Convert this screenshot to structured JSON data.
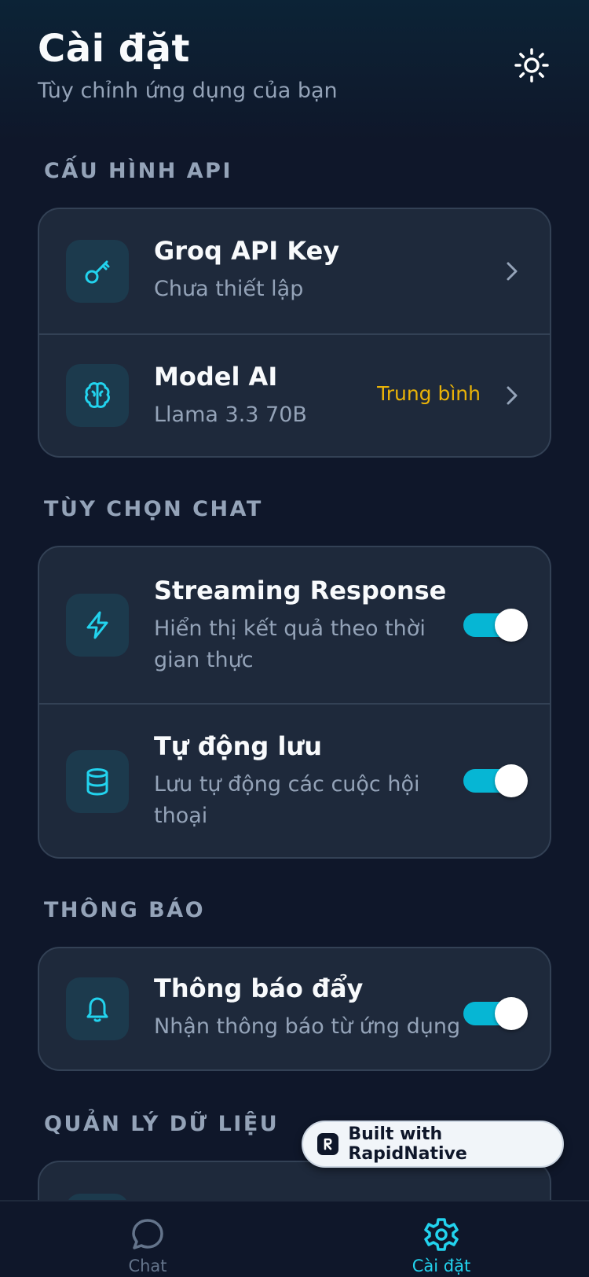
{
  "header": {
    "title": "Cài đặt",
    "subtitle": "Tùy chỉnh ứng dụng của bạn",
    "theme_icon": "sun-icon"
  },
  "sections": {
    "api": {
      "title": "CẤU HÌNH API",
      "groq": {
        "title": "Groq API Key",
        "subtitle": "Chưa thiết lập",
        "icon": "key-icon"
      },
      "model": {
        "title": "Model AI",
        "subtitle": "Llama 3.3 70B",
        "badge": "Trung bình",
        "icon": "brain-icon"
      }
    },
    "chat": {
      "title": "TÙY CHỌN CHAT",
      "streaming": {
        "title": "Streaming Response",
        "subtitle_line1": "Hiển thị kết quả theo thời",
        "subtitle_line2": "gian thực",
        "enabled": true,
        "icon": "lightning-icon"
      },
      "autosave": {
        "title": "Tự động lưu",
        "subtitle_line1": "Lưu tự động các cuộc hội",
        "subtitle_line2": "thoại",
        "enabled": true,
        "icon": "database-icon"
      }
    },
    "notifications": {
      "title": "THÔNG BÁO",
      "push": {
        "title": "Thông báo đẩy",
        "subtitle": "Nhận thông báo từ ứng dụng",
        "enabled": true,
        "icon": "bell-icon"
      }
    },
    "data": {
      "title": "QUẢN LÝ DỮ LIỆU"
    }
  },
  "built_badge": {
    "text": "Built with RapidNative"
  },
  "tabbar": {
    "tabs": [
      {
        "label": "Chat",
        "icon": "chat-bubble-icon",
        "active": false
      },
      {
        "label": "Cài đặt",
        "icon": "gear-icon",
        "active": true
      }
    ]
  },
  "colors": {
    "background": "#0f172a",
    "card": "#1e293b",
    "accent": "#06b6d4",
    "badge": "#eab308",
    "muted": "#94a3b8",
    "tab_inactive": "#64748b"
  }
}
